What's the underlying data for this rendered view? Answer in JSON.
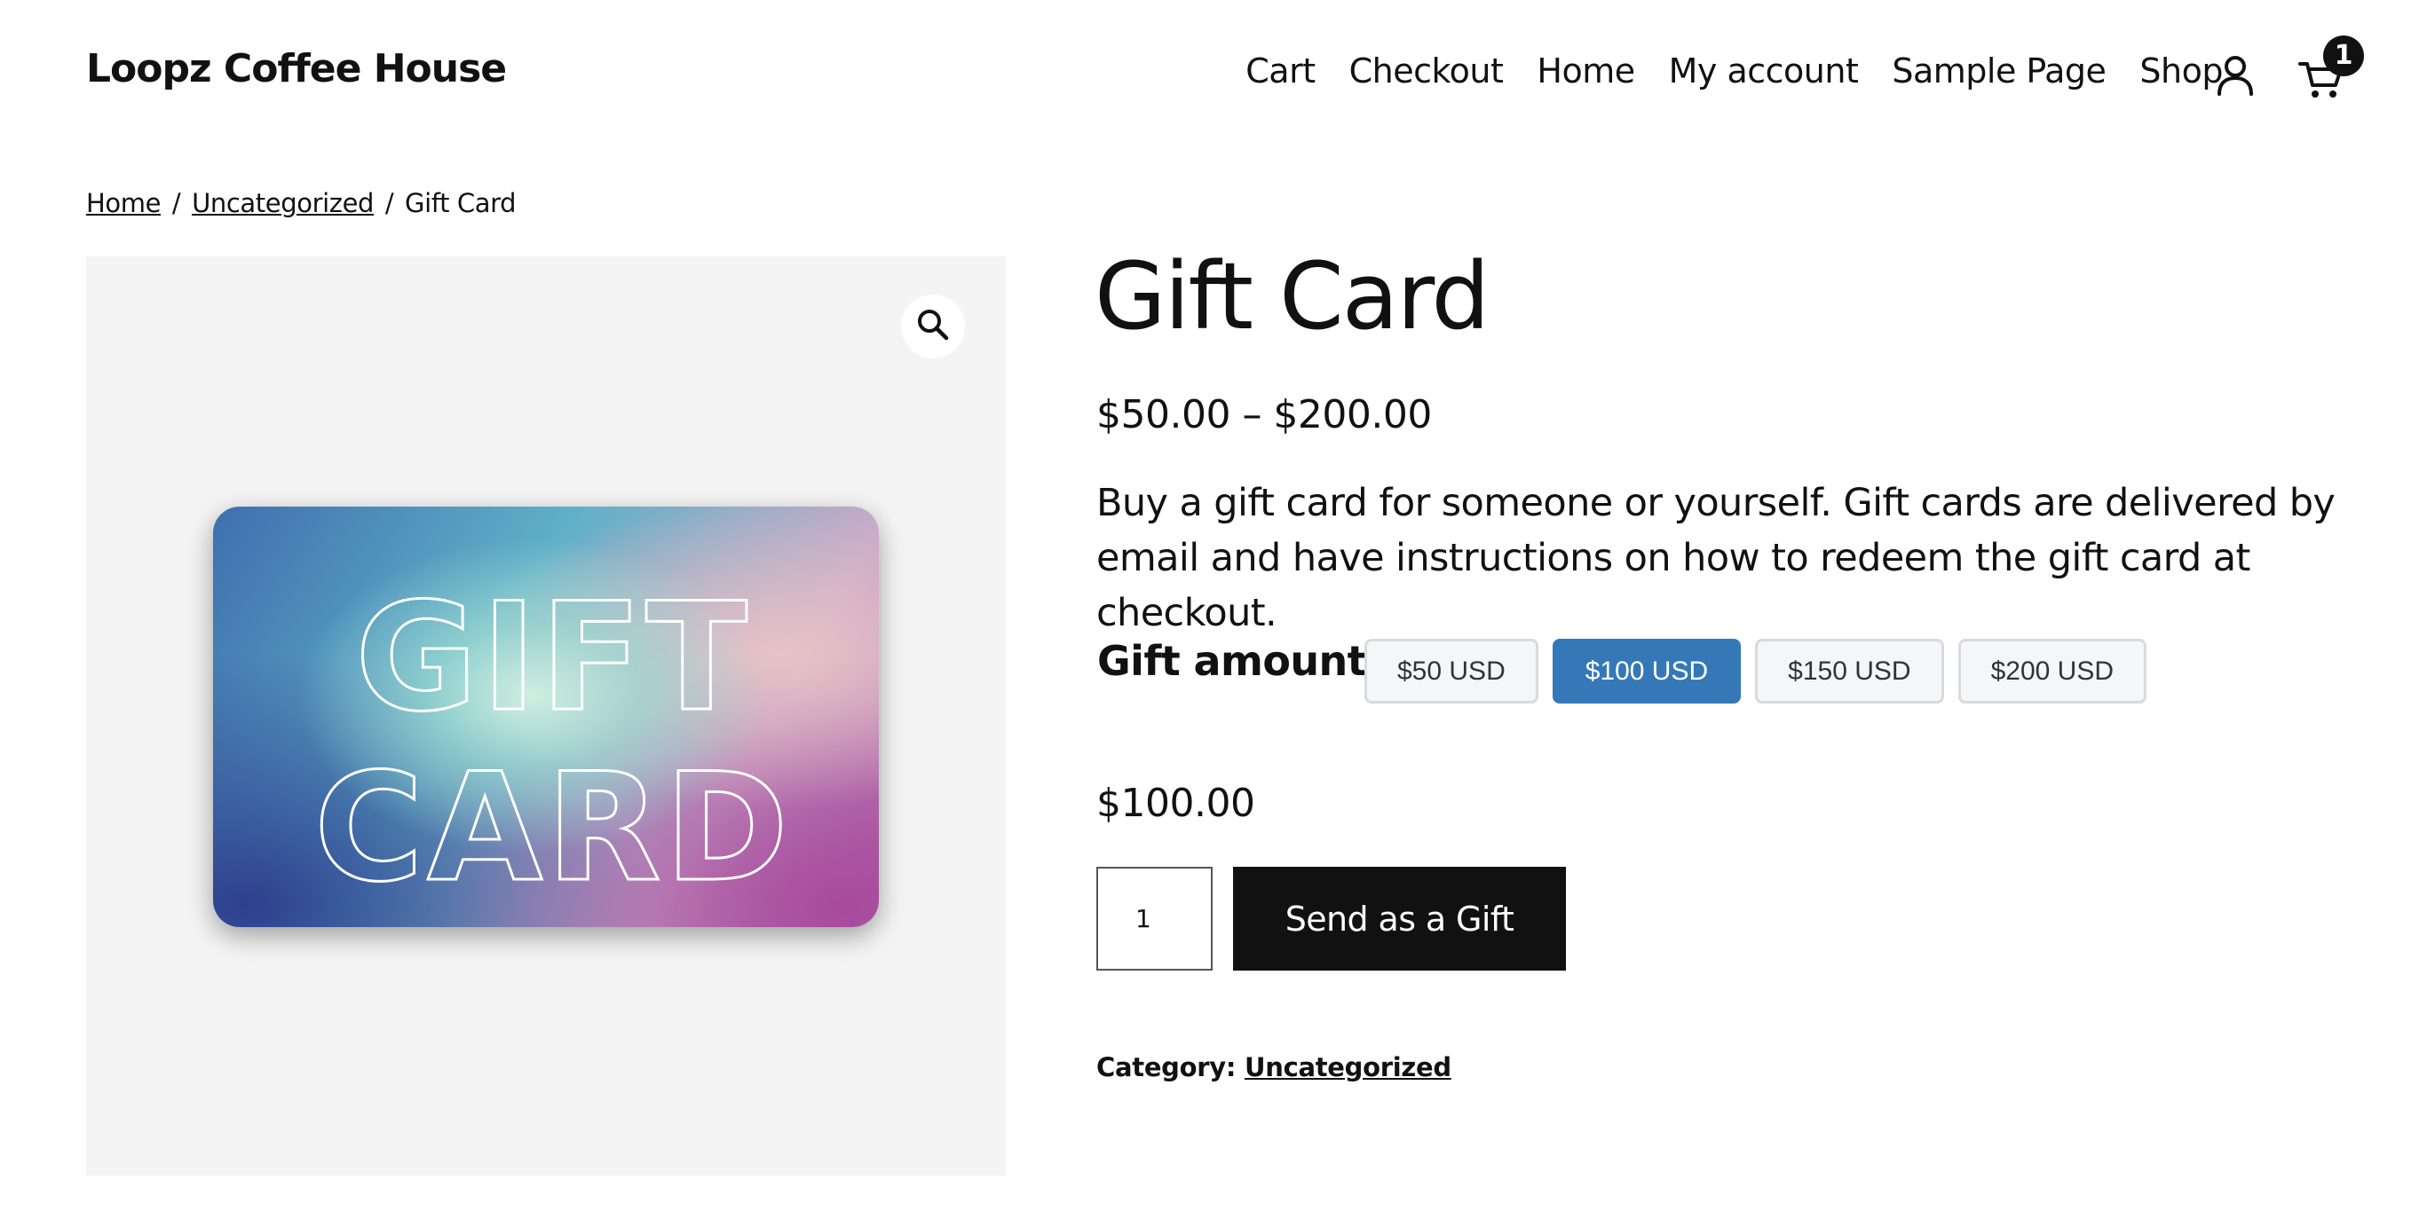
{
  "site": {
    "title": "Loopz Coffee House"
  },
  "nav": {
    "items": [
      {
        "label": "Cart"
      },
      {
        "label": "Checkout"
      },
      {
        "label": "Home"
      },
      {
        "label": "My account"
      },
      {
        "label": "Sample Page"
      },
      {
        "label": "Shop"
      }
    ],
    "account_icon": "user-icon",
    "cart_icon": "cart-icon",
    "cart_count": "1"
  },
  "breadcrumb": {
    "items": [
      "Home",
      "Uncategorized"
    ],
    "current": "Gift Card",
    "separator": "/"
  },
  "gallery": {
    "zoom_icon": "magnifier-icon",
    "image_text": [
      "GIFT",
      "CARD"
    ]
  },
  "product": {
    "title": "Gift Card",
    "price_range": "$50.00 – $200.00",
    "description": "Buy a gift card for someone or yourself. Gift cards are delivered by email and have instructions on how to redeem the gift card at checkout.",
    "gift_amount_label": "Gift amount",
    "amounts": [
      {
        "label": "$50 USD",
        "selected": false
      },
      {
        "label": "$100 USD",
        "selected": true
      },
      {
        "label": "$150 USD",
        "selected": false
      },
      {
        "label": "$200 USD",
        "selected": false
      }
    ],
    "selected_price": "$100.00",
    "quantity": "1",
    "send_button_label": "Send as a Gift",
    "category_label": "Category:",
    "category": "Uncategorized"
  },
  "colors": {
    "accent": "#3478b8",
    "button": "#111111",
    "gallery_bg": "#f4f4f4"
  }
}
